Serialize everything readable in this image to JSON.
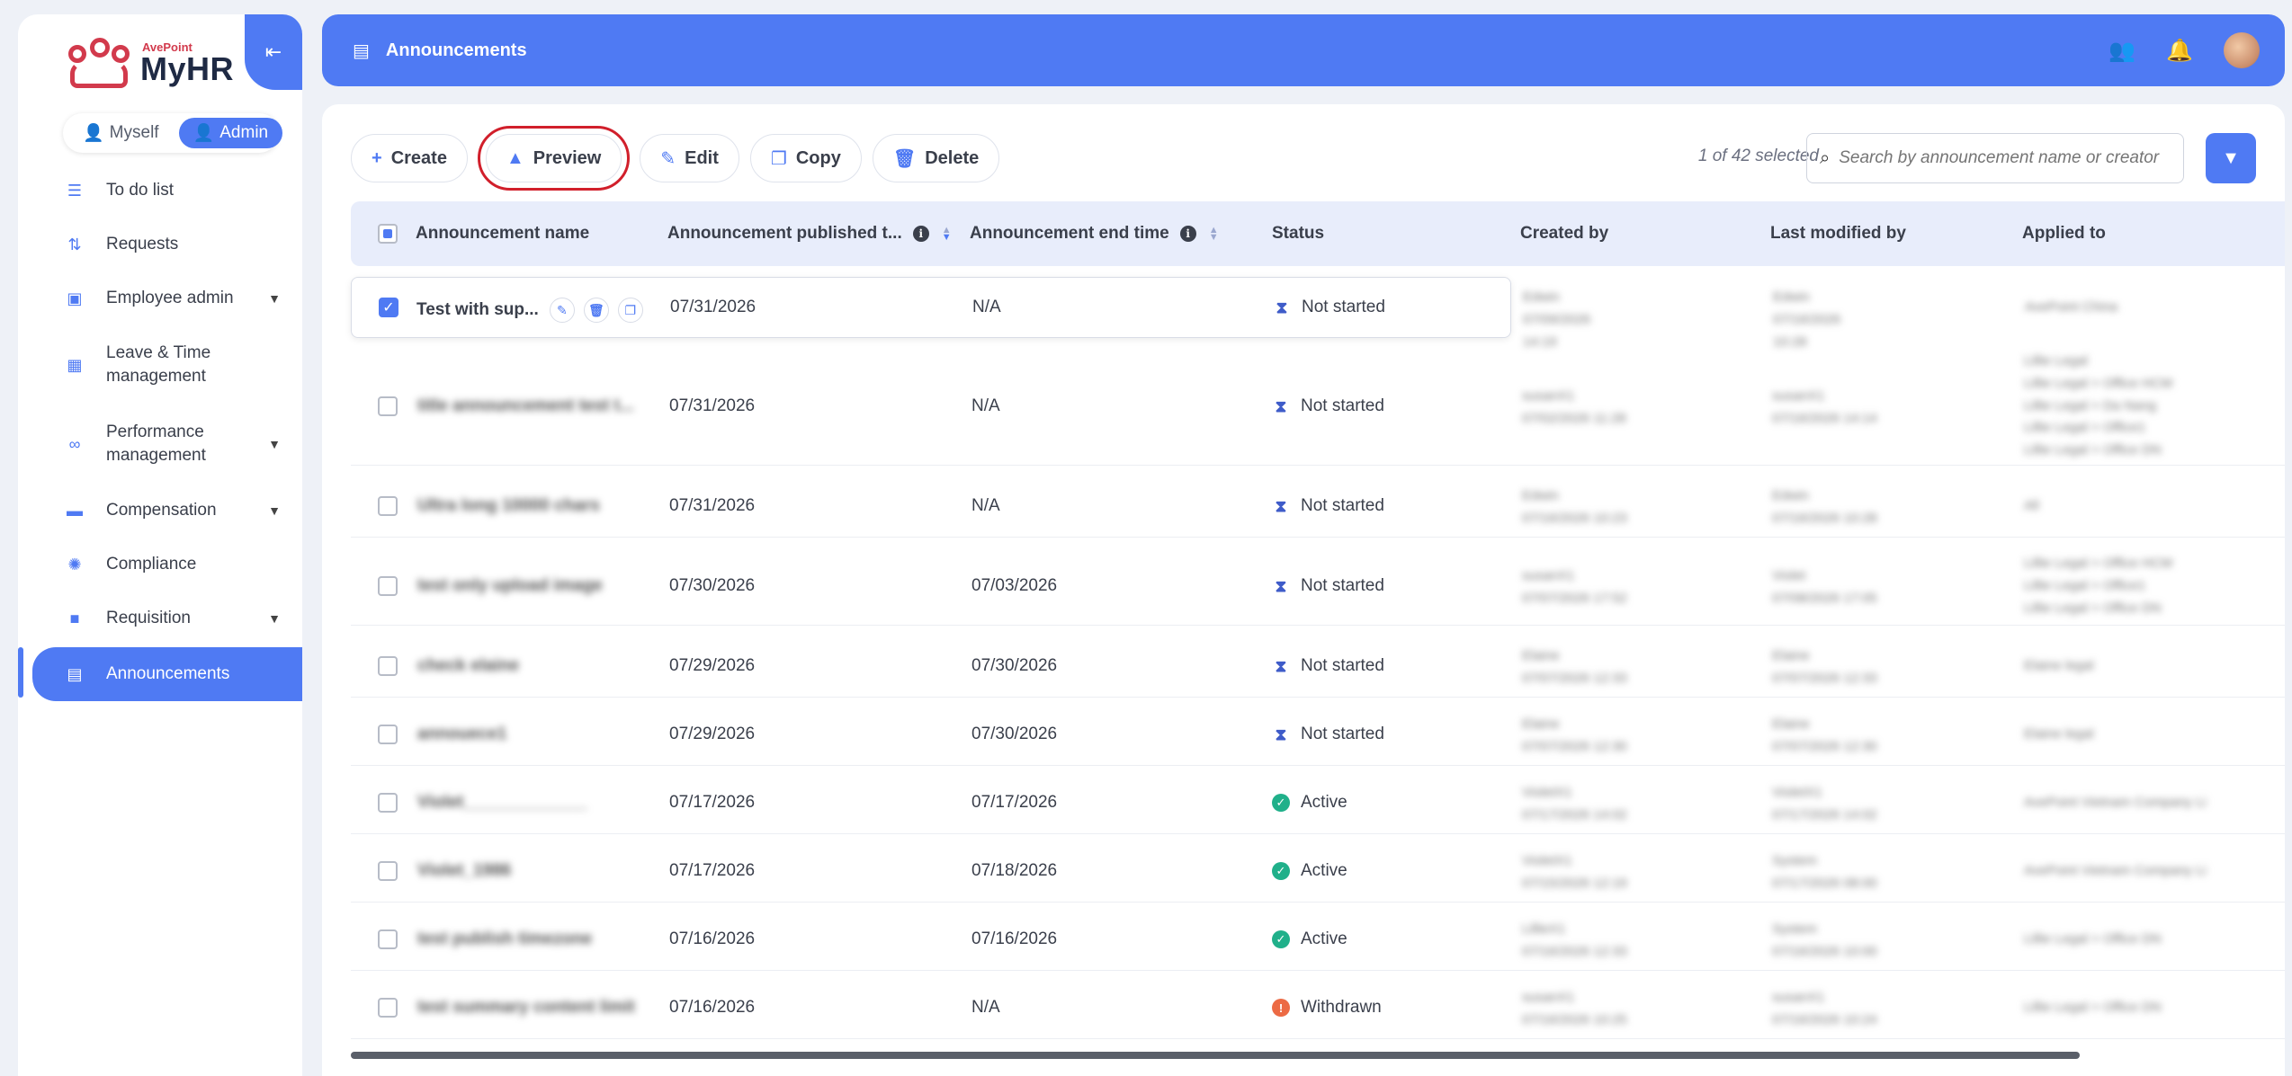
{
  "app": {
    "brand_small": "AvePoint",
    "brand_name": "MyHR"
  },
  "role_switch": {
    "myself": "Myself",
    "admin": "Admin"
  },
  "sidebar": {
    "items": [
      {
        "label": "To do list",
        "icon": "list-check-icon"
      },
      {
        "label": "Requests",
        "icon": "pull-request-icon"
      },
      {
        "label": "Employee admin",
        "icon": "id-badge-icon"
      },
      {
        "label": "Leave & Time management",
        "icon": "calendar-icon"
      },
      {
        "label": "Performance management",
        "icon": "binoculars-icon"
      },
      {
        "label": "Compensation",
        "icon": "wallet-icon"
      },
      {
        "label": "Compliance",
        "icon": "shield-gear-icon"
      },
      {
        "label": "Requisition",
        "icon": "briefcase-icon"
      },
      {
        "label": "Announcements",
        "icon": "newspaper-icon"
      }
    ]
  },
  "header": {
    "title": "Announcements"
  },
  "toolbar": {
    "create": "Create",
    "preview": "Preview",
    "edit": "Edit",
    "copy": "Copy",
    "delete": "Delete",
    "selected_count": "1 of 42 selected"
  },
  "search": {
    "placeholder": "Search by announcement name or creator"
  },
  "table": {
    "columns": {
      "name": "Announcement name",
      "published": "Announcement published t...",
      "end": "Announcement end time",
      "status": "Status",
      "created_by": "Created by",
      "modified_by": "Last modified by",
      "applied_to": "Applied to"
    },
    "rows": [
      {
        "name": "Test with sup...",
        "published": "07/31/2026",
        "end": "N/A",
        "status": "Not started",
        "created": "Edwin",
        "created_time": "07/09/2026 14:19",
        "modified": "Edwin",
        "modified_time": "07/16/2026 10:28",
        "applied": [
          "AvePoint China"
        ]
      },
      {
        "name": "title announcement test t...",
        "published": "07/31/2026",
        "end": "N/A",
        "status": "Not started",
        "created": "susanX1",
        "created_time": "07/02/2026 11:28",
        "modified": "susanX1",
        "modified_time": "07/16/2026 14:14",
        "applied": [
          "Lillie Legal",
          "Lillie Legal > Office HCM",
          "Lillie Legal > Da Nang",
          "Lillie Legal > Office1",
          "Lillie Legal > Office DN"
        ]
      },
      {
        "name": "Ultra long 10000 chars",
        "published": "07/31/2026",
        "end": "N/A",
        "status": "Not started",
        "created": "Edwin",
        "created_time": "07/16/2026 10:23",
        "modified": "Edwin",
        "modified_time": "07/16/2026 10:28",
        "applied": [
          "All"
        ]
      },
      {
        "name": "test only upload image",
        "published": "07/30/2026",
        "end": "07/03/2026",
        "status": "Not started",
        "created": "susanX1",
        "created_time": "07/07/2026 17:52",
        "modified": "Violet",
        "modified_time": "07/08/2026 17:05",
        "applied": [
          "Lillie Legal > Office HCM",
          "Lillie Legal > Office1",
          "Lillie Legal > Office DN"
        ]
      },
      {
        "name": "check elaine",
        "published": "07/29/2026",
        "end": "07/30/2026",
        "status": "Not started",
        "created": "Elaine",
        "created_time": "07/07/2026 12:33",
        "modified": "Elaine",
        "modified_time": "07/07/2026 12:33",
        "applied": [
          "Elaine legal"
        ]
      },
      {
        "name": "annouece1",
        "published": "07/29/2026",
        "end": "07/30/2026",
        "status": "Not started",
        "created": "Elaine",
        "created_time": "07/07/2026 12:30",
        "modified": "Elaine",
        "modified_time": "07/07/2026 12:30",
        "applied": [
          "Elaine legal"
        ]
      },
      {
        "name": "Violet_____________",
        "published": "07/17/2026",
        "end": "07/17/2026",
        "status": "Active",
        "created": "VioletX1",
        "created_time": "07/17/2026 14:02",
        "modified": "VioletX1",
        "modified_time": "07/17/2026 14:02",
        "applied": [
          "AvePoint Vietnam Company Li"
        ]
      },
      {
        "name": "Violet_1986",
        "published": "07/17/2026",
        "end": "07/18/2026",
        "status": "Active",
        "created": "VioletX1",
        "created_time": "07/15/2026 12:19",
        "modified": "System",
        "modified_time": "07/17/2026 08:00",
        "applied": [
          "AvePoint Vietnam Company Li"
        ]
      },
      {
        "name": "test publish timezone",
        "published": "07/16/2026",
        "end": "07/16/2026",
        "status": "Active",
        "created": "LillieX1",
        "created_time": "07/16/2026 12:33",
        "modified": "System",
        "modified_time": "07/16/2026 10:00",
        "applied": [
          "Lillie Legal > Office DN"
        ]
      },
      {
        "name": "test summary content limit",
        "published": "07/16/2026",
        "end": "N/A",
        "status": "Withdrawn",
        "created": "susanX1",
        "created_time": "07/16/2026 10:25",
        "modified": "susanX1",
        "modified_time": "07/16/2026 10:24",
        "applied": [
          "Lillie Legal > Office DN"
        ]
      }
    ]
  },
  "colors": {
    "accent": "#4f7af3",
    "highlight": "#d11f2b",
    "active": "#20b08a",
    "withdrawn": "#ec6a44",
    "not_started": "#3f5cc9"
  }
}
